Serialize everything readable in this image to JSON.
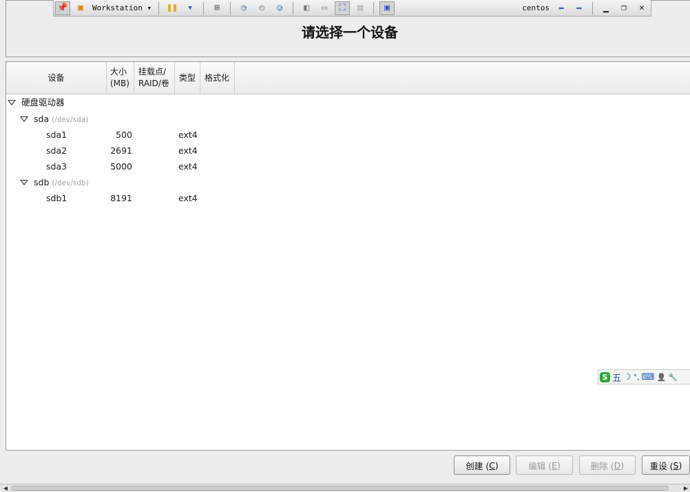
{
  "toolbar": {
    "app_label": "Workstation",
    "vm_name": "centos",
    "icons": [
      "pin-icon",
      "vmware-logo-icon",
      "pause-icon",
      "send-ctrl-alt-del-icon",
      "snapshot-take-icon",
      "snapshot-revert-icon",
      "snapshot-manager-icon",
      "sidebar-view-icon",
      "console-view-icon",
      "fullscreen-icon",
      "unity-icon",
      "monitor-icon",
      "back-arrow-icon",
      "forward-arrow-icon",
      "minimize-icon",
      "restore-icon",
      "close-icon"
    ]
  },
  "header": {
    "title": "请选择一个设备"
  },
  "columns": {
    "device": "设备",
    "size": "大小\n(MB)",
    "mount": "挂载点/\nRAID/卷",
    "type": "类型",
    "format": "格式化"
  },
  "tree": {
    "group_label": "硬盘驱动器",
    "disks": [
      {
        "name": "sda",
        "path": "(/dev/sda)",
        "partitions": [
          {
            "name": "sda1",
            "size": "500",
            "type": "ext4"
          },
          {
            "name": "sda2",
            "size": "2691",
            "type": "ext4"
          },
          {
            "name": "sda3",
            "size": "5000",
            "type": "ext4"
          }
        ]
      },
      {
        "name": "sdb",
        "path": "(/dev/sdb)",
        "partitions": [
          {
            "name": "sdb1",
            "size": "8191",
            "type": "ext4"
          }
        ]
      }
    ]
  },
  "ime": {
    "logo": "S",
    "mode": "五",
    "moon": "☽",
    "punct": "°,",
    "keyboard": "⌨",
    "user": "👤",
    "tool": "🔧"
  },
  "buttons": {
    "create": {
      "label": "创建 (",
      "key": "C",
      "end": ")"
    },
    "edit": {
      "label": "编辑 (",
      "key": "E",
      "end": ")"
    },
    "delete": {
      "label": "删除 (",
      "key": "D",
      "end": ")"
    },
    "reset": {
      "label": "重设 (",
      "key": "S",
      "end": ")"
    }
  }
}
